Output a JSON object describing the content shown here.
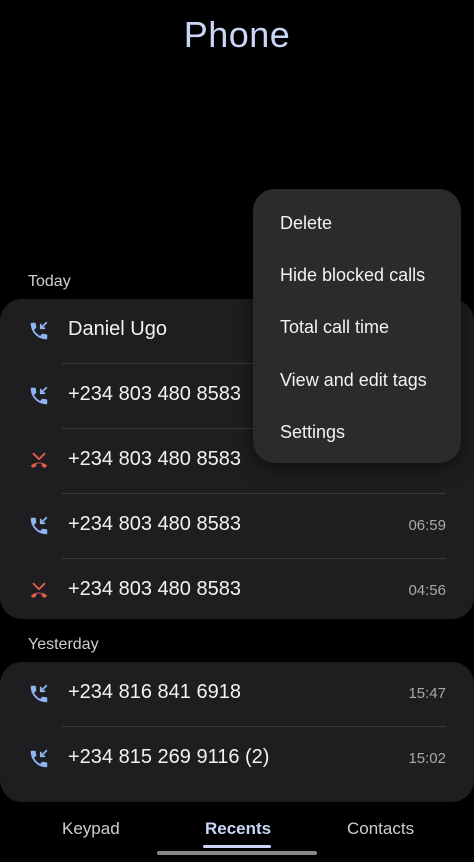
{
  "header": {
    "title": "Phone"
  },
  "sections": {
    "today_label": "Today",
    "yesterday_label": "Yesterday"
  },
  "today_calls": [
    {
      "name": "Daniel Ugo",
      "time": "",
      "type": "incoming"
    },
    {
      "name": "+234 803 480 8583",
      "time": "",
      "type": "incoming"
    },
    {
      "name": "+234 803 480 8583",
      "time": "",
      "type": "missed"
    },
    {
      "name": "+234 803 480 8583",
      "time": "06:59",
      "type": "incoming"
    },
    {
      "name": "+234 803 480 8583",
      "time": "04:56",
      "type": "missed"
    }
  ],
  "yesterday_calls": [
    {
      "name": "+234 816 841 6918",
      "time": "15:47",
      "type": "incoming"
    },
    {
      "name": "+234 815 269 9116 (2)",
      "time": "15:02",
      "type": "incoming"
    }
  ],
  "menu": {
    "items": [
      "Delete",
      "Hide blocked calls",
      "Total call time",
      "View and edit tags",
      "Settings"
    ]
  },
  "nav": {
    "keypad": "Keypad",
    "recents": "Recents",
    "contacts": "Contacts"
  },
  "colors": {
    "accent": "#c9d6f7",
    "incoming_icon": "#8fb4f4",
    "missed_icon": "#e45a4b",
    "card": "#1e1e20",
    "menu": "#2b2b2e"
  },
  "icons": {
    "incoming": "incoming-call-icon",
    "missed": "missed-call-icon"
  }
}
